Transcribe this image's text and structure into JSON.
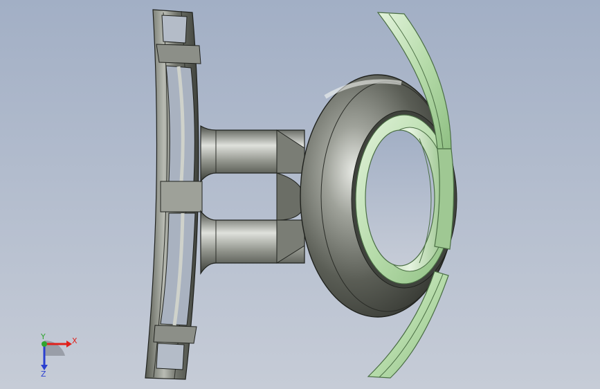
{
  "viewport": {
    "background_top": "#a3b0c6",
    "background_bottom": "#c5cbd6"
  },
  "model": {
    "metal_dark": "#3c3f3a",
    "metal_mid": "#8a8d86",
    "metal_light": "#e6e8e3",
    "selected_face": "#bfe0b5",
    "selected_edge": "#4a6e44"
  },
  "triad": {
    "x_label": "X",
    "y_label": "Y",
    "z_label": "Z",
    "x_color": "#e0201a",
    "y_color": "#2fa52f",
    "z_color": "#2a3fd0"
  }
}
